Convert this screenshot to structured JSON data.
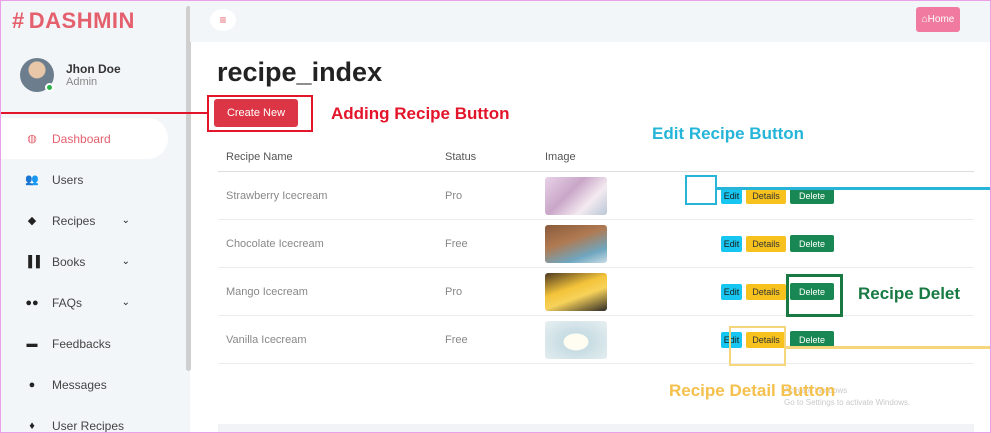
{
  "sidebar": {
    "brand": "DASHMIN",
    "brand_symbol": "#",
    "user": {
      "name": "Jhon Doe",
      "role": "Admin"
    },
    "items": [
      {
        "label": "Dashboard",
        "icon": "dashboard-icon",
        "has_chevron": false,
        "active": true
      },
      {
        "label": "Users",
        "icon": "users-icon",
        "has_chevron": false
      },
      {
        "label": "Recipes",
        "icon": "recipes-icon",
        "has_chevron": true
      },
      {
        "label": "Books",
        "icon": "books-icon",
        "has_chevron": true
      },
      {
        "label": "FAQs",
        "icon": "faqs-icon",
        "has_chevron": true
      },
      {
        "label": "Feedbacks",
        "icon": "feedbacks-icon",
        "has_chevron": false
      },
      {
        "label": "Messages",
        "icon": "messages-icon",
        "has_chevron": false
      },
      {
        "label": "User Recipes",
        "icon": "user-recipes-icon",
        "has_chevron": false
      }
    ]
  },
  "topbar": {
    "home_label": "Home"
  },
  "main": {
    "title": "recipe_index",
    "create_label": "Create New",
    "columns": [
      "Recipe Name",
      "Status",
      "Image",
      ""
    ],
    "actions": {
      "edit": "Edit",
      "details": "Details",
      "delete": "Delete"
    },
    "rows": [
      {
        "name": "Strawberry Icecream",
        "status": "Pro"
      },
      {
        "name": "Chocolate Icecream",
        "status": "Free"
      },
      {
        "name": "Mango Icecream",
        "status": "Pro"
      },
      {
        "name": "Vanilla Icecream",
        "status": "Free"
      }
    ],
    "watermark": [
      "Activate Windows",
      "Go to Settings to activate Windows."
    ]
  },
  "annotations": {
    "create": "Adding Recipe Button",
    "edit": "Edit Recipe Button",
    "delete": "Recipe Delet",
    "details": "Recipe Detail Button"
  },
  "colors": {
    "brand": "#e4606d",
    "create": "#dc3545",
    "edit": "#17c6f0",
    "details": "#f7c21d",
    "delete": "#198754",
    "annotation_red": "#e3152b",
    "annotation_blue": "#26b5d9",
    "annotation_green": "#187a42",
    "annotation_yellow": "#f5c04c"
  }
}
